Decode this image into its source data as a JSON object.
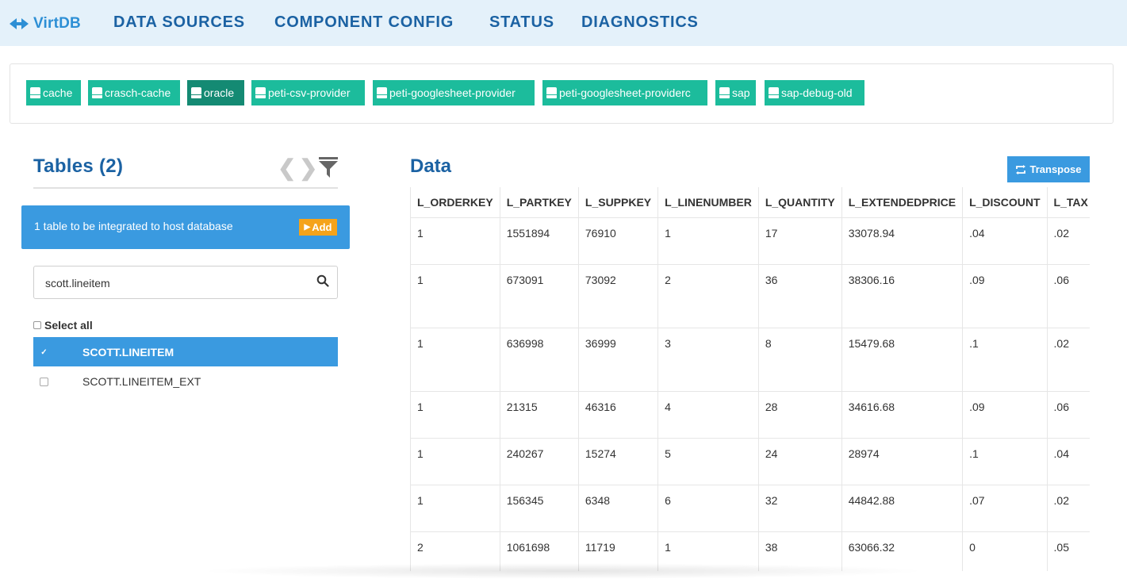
{
  "app": {
    "name": "VirtDB"
  },
  "nav": [
    {
      "label": "DATA SOURCES"
    },
    {
      "label": "COMPONENT CONFIG"
    },
    {
      "label": "STATUS"
    },
    {
      "label": "DIAGNOSTICS"
    }
  ],
  "sources": [
    {
      "label": "cache",
      "active": false
    },
    {
      "label": "crasch-cache",
      "active": false
    },
    {
      "label": "oracle",
      "active": true
    },
    {
      "label": "peti-csv-provider",
      "active": false
    },
    {
      "label": "peti-googlesheet-provider",
      "active": false
    },
    {
      "label": "peti-googlesheet-providerc",
      "active": false
    },
    {
      "label": "sap",
      "active": false
    },
    {
      "label": "sap-debug-old",
      "active": false
    }
  ],
  "tables_panel": {
    "title": "Tables (2)",
    "integrate_text": "1 table to be integrated to host database",
    "add_label": "Add",
    "search_value": "scott.lineitem",
    "select_all_label": "Select all",
    "items": [
      {
        "name": "SCOTT.LINEITEM",
        "selected": true
      },
      {
        "name": "SCOTT.LINEITEM_EXT",
        "selected": false
      }
    ]
  },
  "data_panel": {
    "title": "Data",
    "transpose_label": "Transpose",
    "columns": [
      "L_ORDERKEY",
      "L_PARTKEY",
      "L_SUPPKEY",
      "L_LINENUMBER",
      "L_QUANTITY",
      "L_EXTENDEDPRICE",
      "L_DISCOUNT",
      "L_TAX"
    ],
    "rows": [
      [
        "1",
        "1551894",
        "76910",
        "1",
        "17",
        "33078.94",
        ".04",
        ".02"
      ],
      [
        "1",
        "673091",
        "73092",
        "2",
        "36",
        "38306.16",
        ".09",
        ".06"
      ],
      [
        "1",
        "636998",
        "36999",
        "3",
        "8",
        "15479.68",
        ".1",
        ".02"
      ],
      [
        "1",
        "21315",
        "46316",
        "4",
        "28",
        "34616.68",
        ".09",
        ".06"
      ],
      [
        "1",
        "240267",
        "15274",
        "5",
        "24",
        "28974",
        ".1",
        ".04"
      ],
      [
        "1",
        "156345",
        "6348",
        "6",
        "32",
        "44842.88",
        ".07",
        ".02"
      ],
      [
        "2",
        "1061698",
        "11719",
        "1",
        "38",
        "63066.32",
        "0",
        ".05"
      ]
    ]
  },
  "colors": {
    "nav_bg": "#e4f1fa",
    "nav_text": "#1b62a3",
    "source_tag": "#1cbc9c",
    "source_tag_active": "#148a73",
    "primary": "#3a9ae0",
    "add_button": "#f5a31a"
  }
}
